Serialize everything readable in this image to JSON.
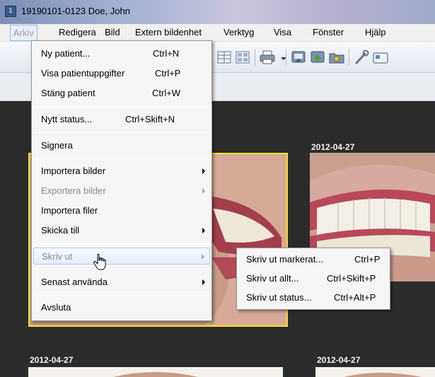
{
  "window": {
    "title": "19190101-0123 Doe, John",
    "icon": "app-icon"
  },
  "menubar": {
    "items": [
      "Arkiv",
      "Redigera",
      "Bild",
      "Extern bildenhet",
      "Verktyg",
      "Visa",
      "Fönster",
      "Hjälp"
    ]
  },
  "toolbar": {
    "icons": [
      "layout-grid-icon",
      "layout-quad-icon",
      "printer-icon",
      "dropdown-arrow-icon",
      "import-icon",
      "export-icon",
      "folder-icon",
      "wrench-icon",
      "camera-icon"
    ]
  },
  "gallery": {
    "dates": [
      "2012-04-27",
      "2012-04-27",
      "2012-04-27"
    ]
  },
  "arkiv_menu": {
    "items": [
      {
        "label": "Ny patient...",
        "shortcut": "Ctrl+N"
      },
      {
        "label": "Visa patientuppgifter",
        "shortcut": "Ctrl+P"
      },
      {
        "label": "Stäng patient",
        "shortcut": "Ctrl+W"
      },
      {
        "label": "Nytt status...",
        "shortcut": "Ctrl+Skift+N"
      },
      {
        "label": "Signera",
        "shortcut": ""
      },
      {
        "label": "Importera bilder",
        "shortcut": ""
      },
      {
        "label": "Exportera bilder",
        "shortcut": ""
      },
      {
        "label": "Importera filer",
        "shortcut": ""
      },
      {
        "label": "Skicka till",
        "shortcut": ""
      },
      {
        "label": "Skriv ut",
        "shortcut": ""
      },
      {
        "label": "Senast använda",
        "shortcut": ""
      },
      {
        "label": "Avsluta",
        "shortcut": ""
      }
    ]
  },
  "print_submenu": {
    "items": [
      {
        "label": "Skriv ut markerat...",
        "shortcut": "Ctrl+P"
      },
      {
        "label": "Skriv ut allt...",
        "shortcut": "Ctrl+Skift+P"
      },
      {
        "label": "Skriv ut status...",
        "shortcut": "Ctrl+Alt+P"
      }
    ]
  },
  "colors": {
    "selection_border": "#f5e11e",
    "background_dark": "#2b2b2b"
  }
}
